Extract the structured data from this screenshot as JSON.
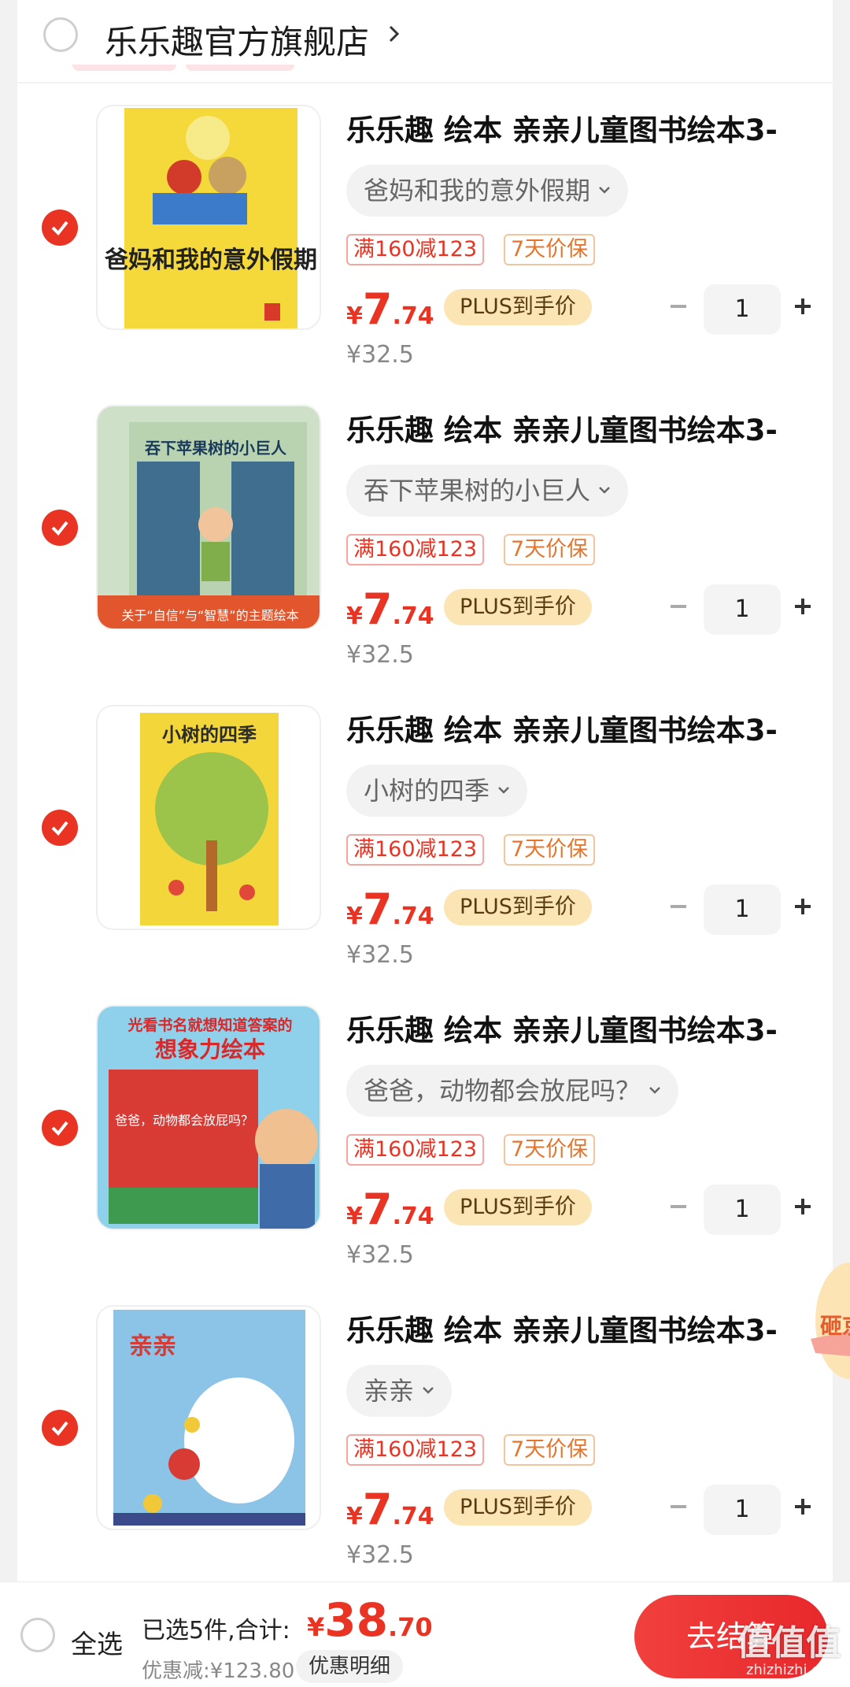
{
  "shop": {
    "name": "乐乐趣官方旗舰店"
  },
  "items": [
    {
      "title": "乐乐趣 绘本 亲亲儿童图书绘本3-",
      "variant": "爸妈和我的意外假期",
      "tag1": "满160减123",
      "tag2": "7天价保",
      "price_yen": "¥",
      "price_int": "7",
      "price_dec": ".74",
      "plus_badge": "PLUS到手价",
      "qty": "1",
      "orig_price": "¥32.5",
      "cover_text": "爸妈和我的意外假期",
      "cover_color": "#f5d83a"
    },
    {
      "title": "乐乐趣 绘本 亲亲儿童图书绘本3-",
      "variant": "吞下苹果树的小巨人",
      "tag1": "满160减123",
      "tag2": "7天价保",
      "price_yen": "¥",
      "price_int": "7",
      "price_dec": ".74",
      "plus_badge": "PLUS到手价",
      "qty": "1",
      "orig_price": "¥32.5",
      "cover_text": "吞下苹果树的小巨人",
      "cover_caption": "关于“自信”与“智慧”的主题绘本",
      "cover_color": "#cfe0c8"
    },
    {
      "title": "乐乐趣 绘本 亲亲儿童图书绘本3-",
      "variant": "小树的四季",
      "tag1": "满160减123",
      "tag2": "7天价保",
      "price_yen": "¥",
      "price_int": "7",
      "price_dec": ".74",
      "plus_badge": "PLUS到手价",
      "qty": "1",
      "orig_price": "¥32.5",
      "cover_text": "小树的四季",
      "cover_color": "#f2d63a"
    },
    {
      "title": "乐乐趣 绘本 亲亲儿童图书绘本3-",
      "variant": "爸爸，动物都会放屁吗？",
      "tag1": "满160减123",
      "tag2": "7天价保",
      "price_yen": "¥",
      "price_int": "7",
      "price_dec": ".74",
      "plus_badge": "PLUS到手价",
      "qty": "1",
      "orig_price": "¥32.5",
      "cover_banner": "光看书名就想知道答案的",
      "cover_heading": "想象力绘本",
      "cover_text": "爸爸，动物都会放屁吗？",
      "cover_color": "#8fd0ea"
    },
    {
      "title": "乐乐趣 绘本 亲亲儿童图书绘本3-",
      "variant": "亲亲",
      "tag1": "满160减123",
      "tag2": "7天价保",
      "price_yen": "¥",
      "price_int": "7",
      "price_dec": ".74",
      "plus_badge": "PLUS到手价",
      "qty": "1",
      "orig_price": "¥32.5",
      "cover_text": "亲亲",
      "cover_color": "#8cc4e8"
    }
  ],
  "footer": {
    "select_all": "全选",
    "selected_count": "已选5件,合计:",
    "total_yen": "¥",
    "total_int": "38",
    "total_dec": ".70",
    "discount": "优惠减:¥123.80",
    "detail_button": "优惠明细",
    "checkout_button": "去结算"
  },
  "float_badge": {
    "label": "砸京"
  },
  "watermark": {
    "text": "值值值",
    "sub": "zhizhizhi.com"
  },
  "colors": {
    "accent": "#e93323",
    "plus_badge_bg": "#fbe5b4"
  }
}
